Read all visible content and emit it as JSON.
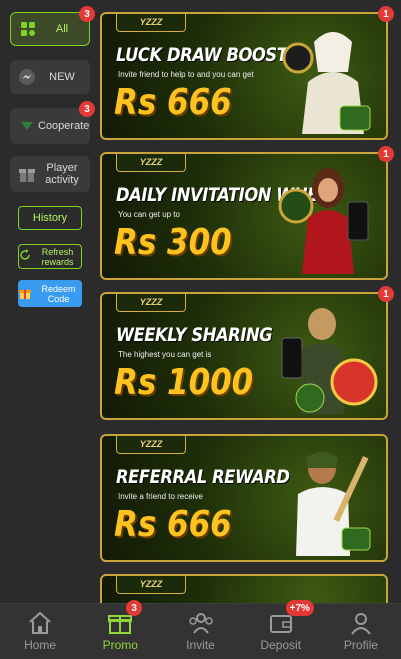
{
  "sidebar": {
    "categories": [
      {
        "label": "All",
        "icon": "grid-icon",
        "badge": "3",
        "active": true
      },
      {
        "label": "NEW",
        "icon": "messenger-icon"
      },
      {
        "label": "Cooperate",
        "icon": "chevron-down-icon",
        "badge": "3"
      },
      {
        "label": "Player activity",
        "icon": "gift-icon"
      }
    ],
    "history_label": "History",
    "refresh_label": "Refresh rewards",
    "redeem_label": "Redeem Code"
  },
  "banners": [
    {
      "tag": "YZZZ",
      "title": "LUCK DRAW BOOST",
      "subtitle": "Invite friend to help to and you can get",
      "amount": "Rs 666",
      "badge": "1"
    },
    {
      "tag": "YZZZ",
      "title": "DAILY INVITATION WHEEL",
      "subtitle": "You can get up to",
      "amount": "Rs 300",
      "badge": "1"
    },
    {
      "tag": "YZZZ",
      "title": "WEEKLY SHARING",
      "subtitle": "The highest you can get is",
      "amount": "Rs 1000",
      "badge": "1"
    },
    {
      "tag": "YZZZ",
      "title": "REFERRAL REWARD",
      "subtitle": "Invite a friend to receive",
      "amount": "Rs 666"
    },
    {
      "tag": "YZZZ"
    }
  ],
  "bottom_nav": [
    {
      "label": "Home",
      "icon": "home-icon"
    },
    {
      "label": "Promo",
      "icon": "gift-icon",
      "badge": "3",
      "active": true
    },
    {
      "label": "Invite",
      "icon": "invite-icon"
    },
    {
      "label": "Deposit",
      "icon": "wallet-icon",
      "badge": "+7%"
    },
    {
      "label": "Profile",
      "icon": "profile-icon"
    }
  ],
  "colors": {
    "accent": "#7ed321",
    "badge": "#e53935",
    "gold": "#ffc21e"
  }
}
